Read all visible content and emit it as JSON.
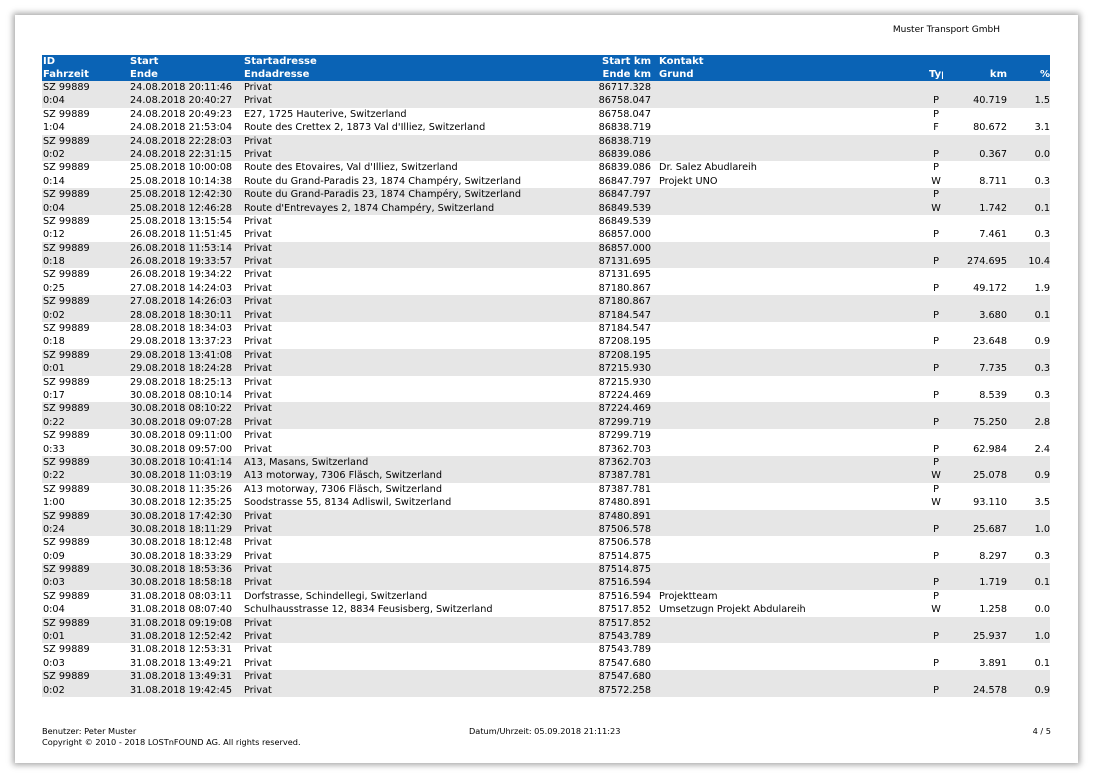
{
  "company": "Muster Transport GmbH",
  "header": {
    "line1": {
      "id": "ID",
      "start": "Start",
      "address": "Startadresse",
      "km": "Start km",
      "contact": "Kontakt",
      "typ": "",
      "km2": "",
      "pct": ""
    },
    "line2": {
      "id": "Fahrzeit",
      "start": "Ende",
      "address": "Endadresse",
      "km": "Ende km",
      "contact": "Grund",
      "typ": "Typ",
      "km2": "km",
      "pct": "%"
    }
  },
  "rows": [
    {
      "id": "SZ 99889",
      "start": "24.08.2018 20:11:46",
      "address": "Privat",
      "km": "86717.328",
      "contact": "",
      "typ": "",
      "km2": "",
      "pct": ""
    },
    {
      "id": "0:04",
      "start": "24.08.2018 20:40:27",
      "address": "Privat",
      "km": "86758.047",
      "contact": "",
      "typ": "P",
      "km2": "40.719",
      "pct": "1.5"
    },
    {
      "id": "SZ 99889",
      "start": "24.08.2018 20:49:23",
      "address": "E27, 1725 Hauterive, Switzerland",
      "km": "86758.047",
      "contact": "",
      "typ": "P",
      "km2": "",
      "pct": ""
    },
    {
      "id": "1:04",
      "start": "24.08.2018 21:53:04",
      "address": "Route des Crettex 2, 1873 Val d'Illiez, Switzerland",
      "km": "86838.719",
      "contact": "",
      "typ": "F",
      "km2": "80.672",
      "pct": "3.1"
    },
    {
      "id": "SZ 99889",
      "start": "24.08.2018 22:28:03",
      "address": "Privat",
      "km": "86838.719",
      "contact": "",
      "typ": "",
      "km2": "",
      "pct": ""
    },
    {
      "id": "0:02",
      "start": "24.08.2018 22:31:15",
      "address": "Privat",
      "km": "86839.086",
      "contact": "",
      "typ": "P",
      "km2": "0.367",
      "pct": "0.0"
    },
    {
      "id": "SZ 99889",
      "start": "25.08.2018 10:00:08",
      "address": "Route des Etovaires, Val d'Illiez, Switzerland",
      "km": "86839.086",
      "contact": "Dr. Salez Abudlareih",
      "typ": "P",
      "km2": "",
      "pct": ""
    },
    {
      "id": "0:14",
      "start": "25.08.2018 10:14:38",
      "address": "Route du Grand-Paradis 23, 1874 Champéry, Switzerland",
      "km": "86847.797",
      "contact": "Projekt UNO",
      "typ": "W",
      "km2": "8.711",
      "pct": "0.3"
    },
    {
      "id": "SZ 99889",
      "start": "25.08.2018 12:42:30",
      "address": "Route du Grand-Paradis 23, 1874 Champéry, Switzerland",
      "km": "86847.797",
      "contact": "",
      "typ": "P",
      "km2": "",
      "pct": ""
    },
    {
      "id": "0:04",
      "start": "25.08.2018 12:46:28",
      "address": "Route d'Entrevayes 2, 1874 Champéry, Switzerland",
      "km": "86849.539",
      "contact": "",
      "typ": "W",
      "km2": "1.742",
      "pct": "0.1"
    },
    {
      "id": "SZ 99889",
      "start": "25.08.2018 13:15:54",
      "address": "Privat",
      "km": "86849.539",
      "contact": "",
      "typ": "",
      "km2": "",
      "pct": ""
    },
    {
      "id": "0:12",
      "start": "26.08.2018 11:51:45",
      "address": "Privat",
      "km": "86857.000",
      "contact": "",
      "typ": "P",
      "km2": "7.461",
      "pct": "0.3"
    },
    {
      "id": "SZ 99889",
      "start": "26.08.2018 11:53:14",
      "address": "Privat",
      "km": "86857.000",
      "contact": "",
      "typ": "",
      "km2": "",
      "pct": ""
    },
    {
      "id": "0:18",
      "start": "26.08.2018 19:33:57",
      "address": "Privat",
      "km": "87131.695",
      "contact": "",
      "typ": "P",
      "km2": "274.695",
      "pct": "10.4"
    },
    {
      "id": "SZ 99889",
      "start": "26.08.2018 19:34:22",
      "address": "Privat",
      "km": "87131.695",
      "contact": "",
      "typ": "",
      "km2": "",
      "pct": ""
    },
    {
      "id": "0:25",
      "start": "27.08.2018 14:24:03",
      "address": "Privat",
      "km": "87180.867",
      "contact": "",
      "typ": "P",
      "km2": "49.172",
      "pct": "1.9"
    },
    {
      "id": "SZ 99889",
      "start": "27.08.2018 14:26:03",
      "address": "Privat",
      "km": "87180.867",
      "contact": "",
      "typ": "",
      "km2": "",
      "pct": ""
    },
    {
      "id": "0:02",
      "start": "28.08.2018 18:30:11",
      "address": "Privat",
      "km": "87184.547",
      "contact": "",
      "typ": "P",
      "km2": "3.680",
      "pct": "0.1"
    },
    {
      "id": "SZ 99889",
      "start": "28.08.2018 18:34:03",
      "address": "Privat",
      "km": "87184.547",
      "contact": "",
      "typ": "",
      "km2": "",
      "pct": ""
    },
    {
      "id": "0:18",
      "start": "29.08.2018 13:37:23",
      "address": "Privat",
      "km": "87208.195",
      "contact": "",
      "typ": "P",
      "km2": "23.648",
      "pct": "0.9"
    },
    {
      "id": "SZ 99889",
      "start": "29.08.2018 13:41:08",
      "address": "Privat",
      "km": "87208.195",
      "contact": "",
      "typ": "",
      "km2": "",
      "pct": ""
    },
    {
      "id": "0:01",
      "start": "29.08.2018 18:24:28",
      "address": "Privat",
      "km": "87215.930",
      "contact": "",
      "typ": "P",
      "km2": "7.735",
      "pct": "0.3"
    },
    {
      "id": "SZ 99889",
      "start": "29.08.2018 18:25:13",
      "address": "Privat",
      "km": "87215.930",
      "contact": "",
      "typ": "",
      "km2": "",
      "pct": ""
    },
    {
      "id": "0:17",
      "start": "30.08.2018 08:10:14",
      "address": "Privat",
      "km": "87224.469",
      "contact": "",
      "typ": "P",
      "km2": "8.539",
      "pct": "0.3"
    },
    {
      "id": "SZ 99889",
      "start": "30.08.2018 08:10:22",
      "address": "Privat",
      "km": "87224.469",
      "contact": "",
      "typ": "",
      "km2": "",
      "pct": ""
    },
    {
      "id": "0:22",
      "start": "30.08.2018 09:07:28",
      "address": "Privat",
      "km": "87299.719",
      "contact": "",
      "typ": "P",
      "km2": "75.250",
      "pct": "2.8"
    },
    {
      "id": "SZ 99889",
      "start": "30.08.2018 09:11:00",
      "address": "Privat",
      "km": "87299.719",
      "contact": "",
      "typ": "",
      "km2": "",
      "pct": ""
    },
    {
      "id": "0:33",
      "start": "30.08.2018 09:57:00",
      "address": "Privat",
      "km": "87362.703",
      "contact": "",
      "typ": "P",
      "km2": "62.984",
      "pct": "2.4"
    },
    {
      "id": "SZ 99889",
      "start": "30.08.2018 10:41:14",
      "address": "A13, Masans, Switzerland",
      "km": "87362.703",
      "contact": "",
      "typ": "P",
      "km2": "",
      "pct": ""
    },
    {
      "id": "0:22",
      "start": "30.08.2018 11:03:19",
      "address": "A13 motorway, 7306 Fläsch, Switzerland",
      "km": "87387.781",
      "contact": "",
      "typ": "W",
      "km2": "25.078",
      "pct": "0.9"
    },
    {
      "id": "SZ 99889",
      "start": "30.08.2018 11:35:26",
      "address": "A13 motorway, 7306 Fläsch, Switzerland",
      "km": "87387.781",
      "contact": "",
      "typ": "P",
      "km2": "",
      "pct": ""
    },
    {
      "id": "1:00",
      "start": "30.08.2018 12:35:25",
      "address": "Soodstrasse 55, 8134 Adliswil, Switzerland",
      "km": "87480.891",
      "contact": "",
      "typ": "W",
      "km2": "93.110",
      "pct": "3.5"
    },
    {
      "id": "SZ 99889",
      "start": "30.08.2018 17:42:30",
      "address": "Privat",
      "km": "87480.891",
      "contact": "",
      "typ": "",
      "km2": "",
      "pct": ""
    },
    {
      "id": "0:24",
      "start": "30.08.2018 18:11:29",
      "address": "Privat",
      "km": "87506.578",
      "contact": "",
      "typ": "P",
      "km2": "25.687",
      "pct": "1.0"
    },
    {
      "id": "SZ 99889",
      "start": "30.08.2018 18:12:48",
      "address": "Privat",
      "km": "87506.578",
      "contact": "",
      "typ": "",
      "km2": "",
      "pct": ""
    },
    {
      "id": "0:09",
      "start": "30.08.2018 18:33:29",
      "address": "Privat",
      "km": "87514.875",
      "contact": "",
      "typ": "P",
      "km2": "8.297",
      "pct": "0.3"
    },
    {
      "id": "SZ 99889",
      "start": "30.08.2018 18:53:36",
      "address": "Privat",
      "km": "87514.875",
      "contact": "",
      "typ": "",
      "km2": "",
      "pct": ""
    },
    {
      "id": "0:03",
      "start": "30.08.2018 18:58:18",
      "address": "Privat",
      "km": "87516.594",
      "contact": "",
      "typ": "P",
      "km2": "1.719",
      "pct": "0.1"
    },
    {
      "id": "SZ 99889",
      "start": "31.08.2018 08:03:11",
      "address": "Dorfstrasse, Schindellegi, Switzerland",
      "km": "87516.594",
      "contact": "Projektteam",
      "typ": "P",
      "km2": "",
      "pct": ""
    },
    {
      "id": "0:04",
      "start": "31.08.2018 08:07:40",
      "address": "Schulhausstrasse 12, 8834 Feusisberg, Switzerland",
      "km": "87517.852",
      "contact": "Umsetzugn Projekt Abdulareih",
      "typ": "W",
      "km2": "1.258",
      "pct": "0.0"
    },
    {
      "id": "SZ 99889",
      "start": "31.08.2018 09:19:08",
      "address": "Privat",
      "km": "87517.852",
      "contact": "",
      "typ": "",
      "km2": "",
      "pct": ""
    },
    {
      "id": "0:01",
      "start": "31.08.2018 12:52:42",
      "address": "Privat",
      "km": "87543.789",
      "contact": "",
      "typ": "P",
      "km2": "25.937",
      "pct": "1.0"
    },
    {
      "id": "SZ 99889",
      "start": "31.08.2018 12:53:31",
      "address": "Privat",
      "km": "87543.789",
      "contact": "",
      "typ": "",
      "km2": "",
      "pct": ""
    },
    {
      "id": "0:03",
      "start": "31.08.2018 13:49:21",
      "address": "Privat",
      "km": "87547.680",
      "contact": "",
      "typ": "P",
      "km2": "3.891",
      "pct": "0.1"
    },
    {
      "id": "SZ 99889",
      "start": "31.08.2018 13:49:31",
      "address": "Privat",
      "km": "87547.680",
      "contact": "",
      "typ": "",
      "km2": "",
      "pct": ""
    },
    {
      "id": "0:02",
      "start": "31.08.2018 19:42:45",
      "address": "Privat",
      "km": "87572.258",
      "contact": "",
      "typ": "P",
      "km2": "24.578",
      "pct": "0.9"
    }
  ],
  "footer": {
    "user": "Benutzer: Peter Muster",
    "copyright": "Copyright © 2010 - 2018 LOSTnFOUND AG. All rights reserved.",
    "datetime": "Datum/Uhrzeit: 05.09.2018 21:11:23",
    "page": "4 / 5"
  }
}
